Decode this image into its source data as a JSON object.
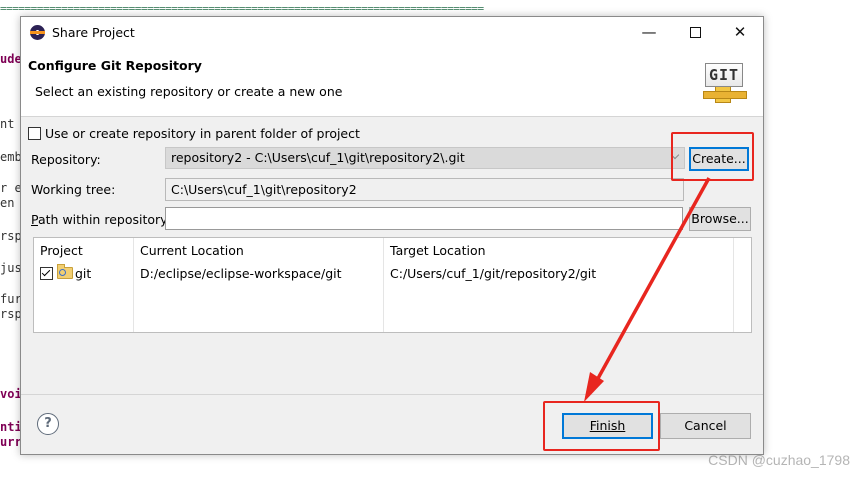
{
  "background": {
    "separator_line": "===============================================================================",
    "code_fragments": [
      "ude",
      "nt",
      "emb",
      "r e",
      "en",
      "rsp",
      "jus",
      "fur",
      "rsp",
      "voi",
      "nti",
      "urr"
    ]
  },
  "watermark": "CSDN @cuzhao_1798",
  "dialog": {
    "window_title": "Share Project",
    "minimize_glyph": "—",
    "close_glyph": "✕",
    "header_title": "Configure Git Repository",
    "header_message": "Select an existing repository or create a new one",
    "logo_text": "GIT",
    "use_parent_label": "Use or create repository in parent folder of project",
    "use_parent_checked": false,
    "repository_label": "Repository:",
    "repository_value": "repository2 - C:\\Users\\cuf_1\\git\\repository2\\.git",
    "create_button": "Create...",
    "working_tree_label": "Working tree:",
    "working_tree_value": "C:\\Users\\cuf_1\\git\\repository2",
    "path_label": "Path within repository:",
    "path_value": "",
    "browse_button": "Browse...",
    "table": {
      "columns": [
        "Project",
        "Current Location",
        "Target Location"
      ],
      "rows": [
        {
          "checked": true,
          "project": "git",
          "current_location": "D:/eclipse/eclipse-workspace/git",
          "target_location": "C:/Users/cuf_1/git/repository2/git"
        }
      ]
    },
    "help_glyph": "?",
    "finish_button": "Finish",
    "cancel_button": "Cancel"
  },
  "colors": {
    "annotation_red": "#e8261f",
    "focus_blue": "#0078d7",
    "dialog_bg": "#f0f0f0"
  }
}
